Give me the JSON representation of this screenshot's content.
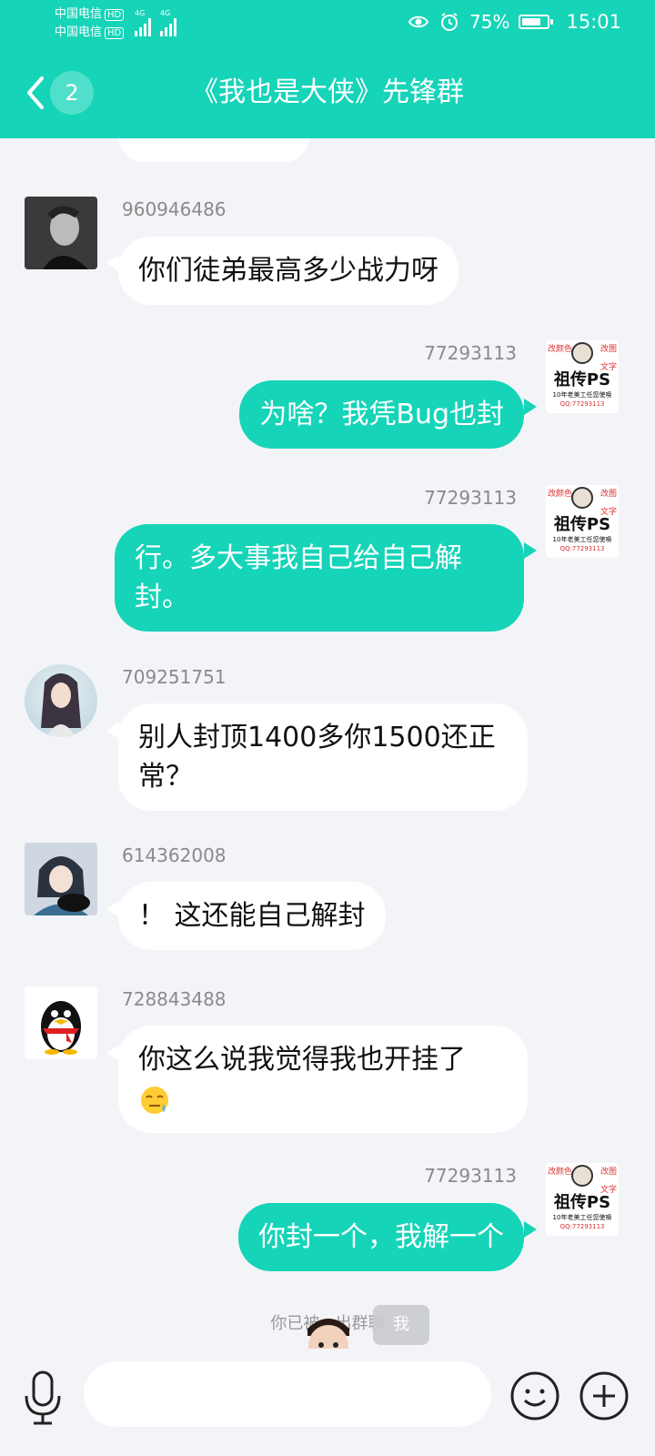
{
  "status_bar": {
    "carrier1": "中国电信",
    "carrier2": "中国电信",
    "hd": "HD",
    "net": "4G",
    "battery": "75%",
    "time": "15:01",
    "battery_level": 0.75
  },
  "header": {
    "unread_count": "2",
    "title": "《我也是大侠》先锋群"
  },
  "colors": {
    "accent": "#16d4b8",
    "background": "#f3f4f8"
  },
  "messages": [
    {
      "sender": "960946486",
      "text": "你们徒弟最高多少战力呀",
      "side": "in",
      "avatar": "man-portrait-avatar"
    },
    {
      "sender": "77293113",
      "text": "为啥？我凭Bug也封",
      "side": "out",
      "avatar": "ps-meme-avatar"
    },
    {
      "sender": "77293113",
      "text": "行。多大事我自己给自己解封。",
      "side": "out",
      "avatar": "ps-meme-avatar"
    },
    {
      "sender": "709251751",
      "text": "别人封顶1400多你1500还正常？",
      "side": "in",
      "avatar": "anime-girl-avatar"
    },
    {
      "sender": "614362008",
      "text": "！ 这还能自己解封",
      "side": "in",
      "avatar": "anime-boy-avatar"
    },
    {
      "sender": "728843488",
      "text": "你这么说我觉得我也开挂了",
      "side": "in",
      "avatar": "qq-penguin-avatar"
    },
    {
      "sender": "77293113",
      "text": "你封一个，我解一个",
      "side": "out",
      "avatar": "ps-meme-avatar"
    }
  ],
  "ps_avatar": {
    "line1": "祖传PS",
    "line2": "10年老美工任您使唤",
    "line3": "QQ:77293113",
    "tag1": "改图",
    "tag2": "改颜色",
    "tag3": "文字"
  },
  "system_note": "你已被...出群聊",
  "me_tag": "我"
}
